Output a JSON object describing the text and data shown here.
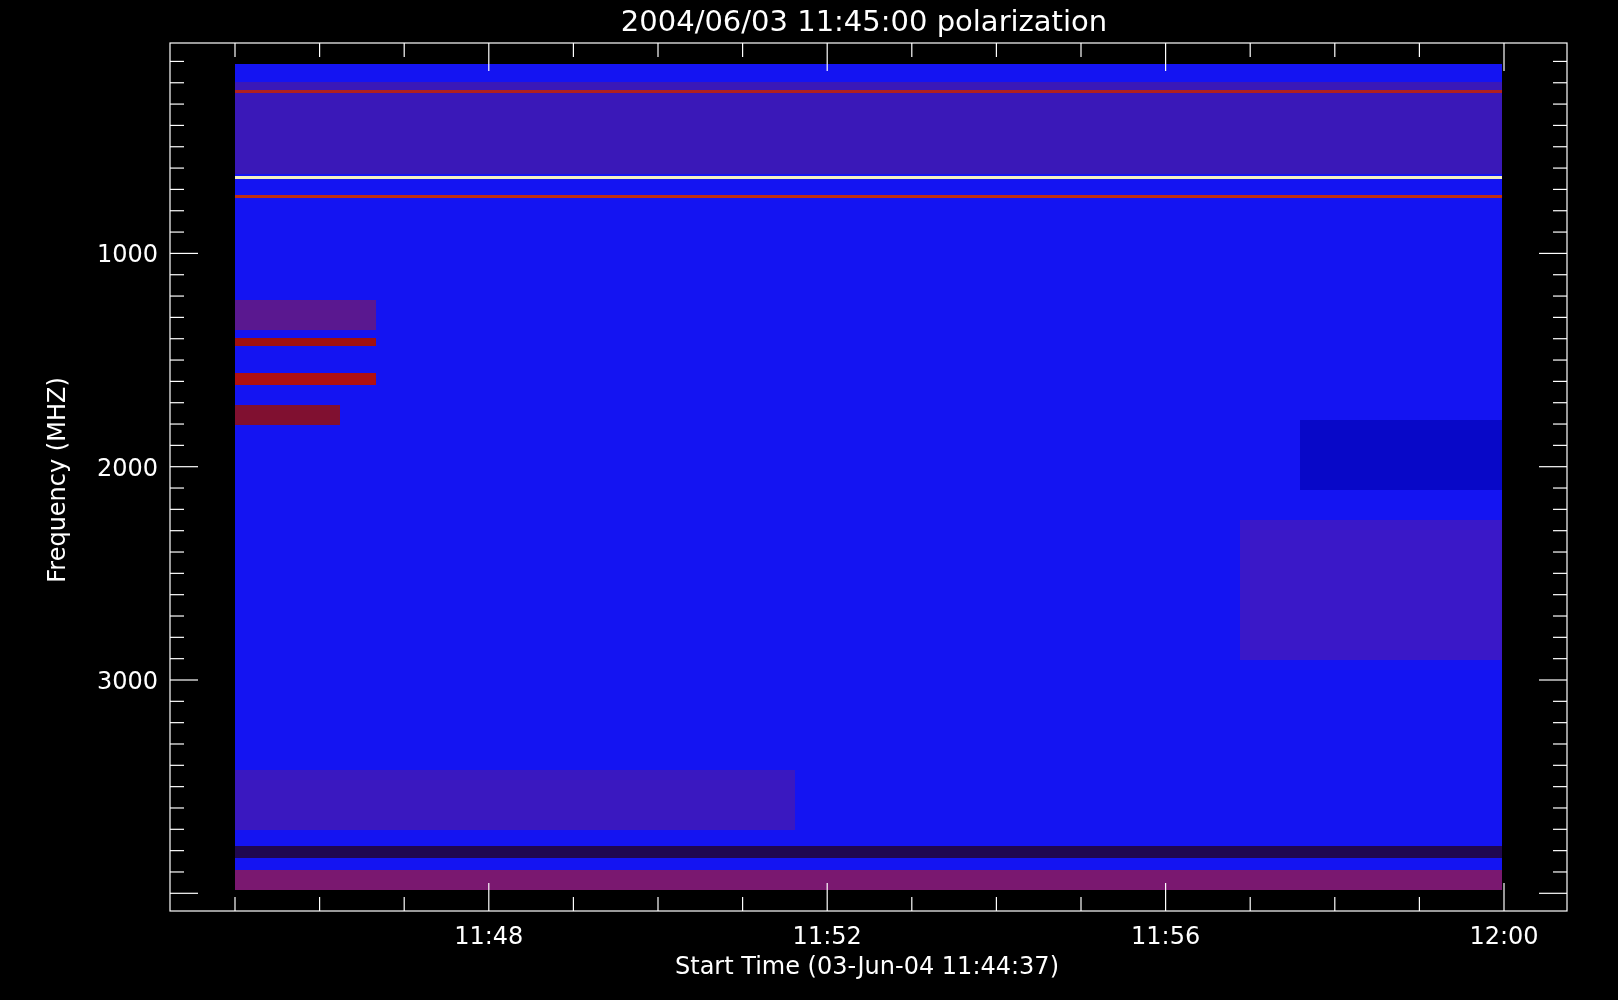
{
  "title": "2004/06/03 11:45:00 polarization",
  "y_axis": {
    "label": "Frequency (MHZ)",
    "tick_labels": [
      "1000",
      "2000",
      "3000"
    ]
  },
  "x_axis": {
    "label": "Start Time (03-Jun-04 11:44:37)",
    "tick_labels": [
      "11:48",
      "11:52",
      "11:56",
      "12:00"
    ]
  }
}
